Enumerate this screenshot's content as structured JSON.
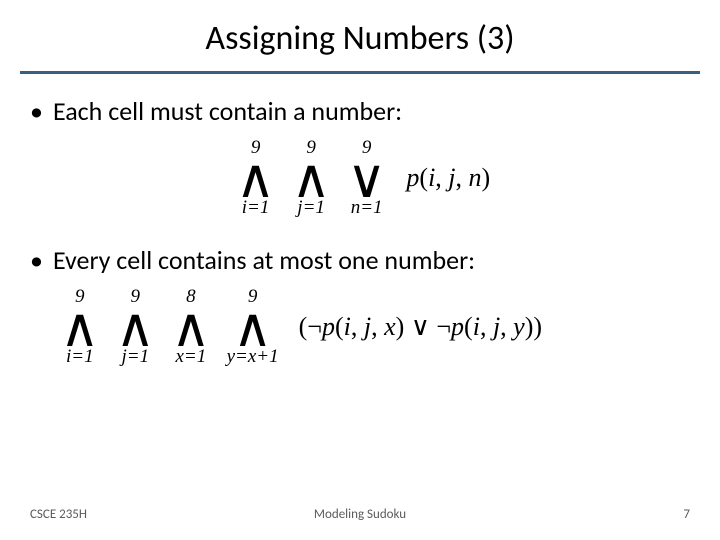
{
  "title": "Assigning Numbers (3)",
  "bullets": {
    "b1": "Each cell must contain a number:",
    "b2": "Every cell contains at most one number:"
  },
  "formula1": {
    "ops": [
      {
        "upper": "9",
        "lower_var": "i",
        "lower_eq": "=",
        "lower_val": "1",
        "sym": "∧"
      },
      {
        "upper": "9",
        "lower_var": "j",
        "lower_eq": "=",
        "lower_val": "1",
        "sym": "∧"
      },
      {
        "upper": "9",
        "lower_var": "n",
        "lower_eq": "=",
        "lower_val": "1",
        "sym": "∨"
      }
    ],
    "expr": {
      "fn": "p",
      "args": [
        "i",
        "j",
        "n"
      ]
    }
  },
  "formula2": {
    "ops": [
      {
        "upper": "9",
        "lower_var": "i",
        "lower_eq": "=",
        "lower_val": "1",
        "sym": "∧"
      },
      {
        "upper": "9",
        "lower_var": "j",
        "lower_eq": "=",
        "lower_val": "1",
        "sym": "∧"
      },
      {
        "upper": "8",
        "lower_var": "x",
        "lower_eq": "=",
        "lower_val": "1",
        "sym": "∧"
      },
      {
        "upper": "9",
        "lower_var": "y",
        "lower_eq": "=",
        "lower_val": "x+1",
        "sym": "∧"
      }
    ],
    "expr": {
      "neg": "¬",
      "or": "∨",
      "fn": "p",
      "left_args": [
        "i",
        "j",
        "x"
      ],
      "right_args": [
        "i",
        "j",
        "y"
      ]
    }
  },
  "footer": {
    "left": "CSCE 235H",
    "center": "Modeling Sudoku",
    "right": "7"
  }
}
